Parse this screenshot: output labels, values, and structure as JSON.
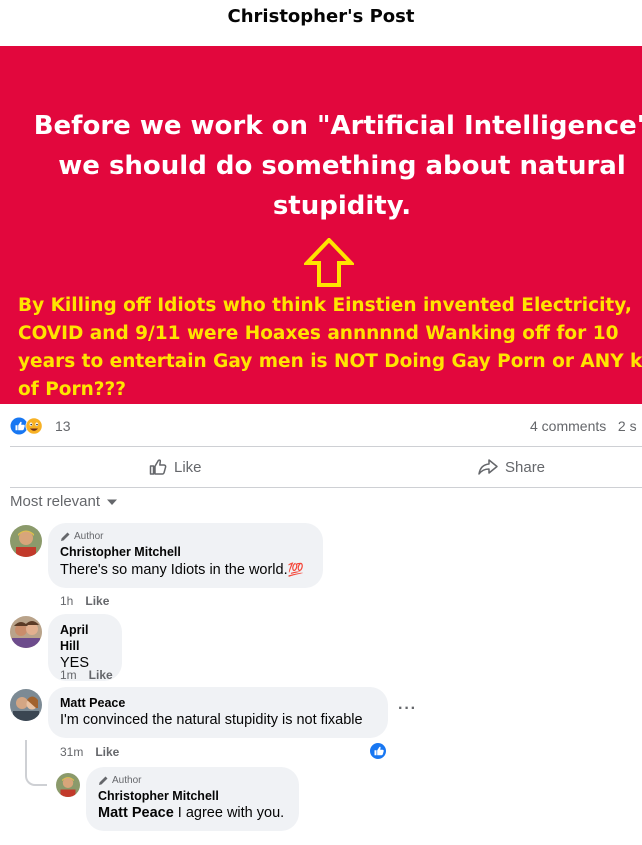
{
  "header": {
    "title": "Christopher's Post"
  },
  "post": {
    "quote_lines": [
      "Before we work on \"Artificial Intelligence\"",
      "we should do something about natural",
      "stupidity."
    ],
    "note_lines": [
      "By Killing off Idiots who think Einstien invented Electricity,",
      "COVID and 9/11 were Hoaxes annnnnd Wanking off for 10",
      "years to entertain Gay men is NOT Doing Gay Porn or ANY kind",
      "of Porn???"
    ],
    "colors": {
      "banner": "#e2073d",
      "quote_text": "#ffffff",
      "note_text": "#ffe400"
    }
  },
  "stats": {
    "reaction_count": "13",
    "comments_label": "4 comments",
    "shares_label": "2 s"
  },
  "actions": {
    "like_label": "Like",
    "share_label": "Share"
  },
  "sort": {
    "label": "Most relevant"
  },
  "comments": [
    {
      "badge": "Author",
      "name": "Christopher Mitchell",
      "text": "There's so many Idiots in the world.",
      "emoji": "💯",
      "time": "1h",
      "like_label": "Like"
    },
    {
      "name": "April Hill",
      "text": "YES",
      "time": "1m",
      "like_label": "Like"
    },
    {
      "name": "Matt Peace",
      "text": "I'm convinced the natural stupidity is not fixable",
      "time": "31m",
      "like_label": "Like",
      "more_icon": "more-options-icon"
    }
  ],
  "reply": {
    "badge": "Author",
    "name": "Christopher Mitchell",
    "mention": "Matt Peace",
    "text": " I agree with you."
  }
}
